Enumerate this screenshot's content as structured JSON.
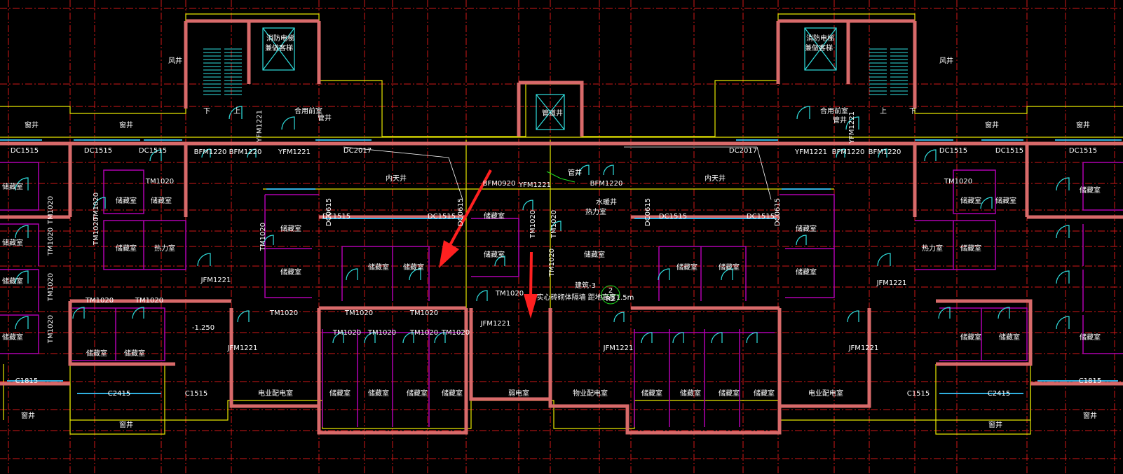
{
  "colors": {
    "background": "#000000",
    "grid": "#d01818",
    "outline": "#e8e800",
    "wall": "#d86a6a",
    "wall_fill": "#e0a080",
    "partition": "#b000b0",
    "door": "#30e0e0",
    "window": "#30b0e0",
    "text": "#ffffff",
    "arrow": "#ff2020",
    "annotation": "#20e020"
  },
  "arrows": [
    {
      "name": "red-arrow-left",
      "note": "pointer"
    },
    {
      "name": "red-arrow-center",
      "note": "pointer"
    }
  ],
  "labels": [
    {
      "t": "消防电梯",
      "id": "l1"
    },
    {
      "t": "兼做客梯",
      "id": "l2"
    },
    {
      "t": "消防电梯",
      "id": "l3"
    },
    {
      "t": "兼做客梯",
      "id": "l4"
    },
    {
      "t": "管道井",
      "id": "l5"
    },
    {
      "t": "风井",
      "id": "l6"
    },
    {
      "t": "风井",
      "id": "l7"
    },
    {
      "t": "窗井",
      "id": "l8"
    },
    {
      "t": "窗井",
      "id": "l9"
    },
    {
      "t": "窗井",
      "id": "l10"
    },
    {
      "t": "窗井",
      "id": "l11"
    },
    {
      "t": "窗井",
      "id": "l12"
    },
    {
      "t": "窗井",
      "id": "l13"
    },
    {
      "t": "窗井",
      "id": "l14"
    },
    {
      "t": "窗井",
      "id": "l15"
    },
    {
      "t": "合用前室",
      "id": "l16"
    },
    {
      "t": "合用前室",
      "id": "l17"
    },
    {
      "t": "下",
      "id": "l18"
    },
    {
      "t": "上",
      "id": "l19"
    },
    {
      "t": "上",
      "id": "l20"
    },
    {
      "t": "下",
      "id": "l21"
    },
    {
      "t": "管井",
      "id": "l22"
    },
    {
      "t": "管井",
      "id": "l23"
    },
    {
      "t": "管井",
      "id": "l24"
    },
    {
      "t": "内天井",
      "id": "l25"
    },
    {
      "t": "内天井",
      "id": "l26"
    },
    {
      "t": "水暖井",
      "id": "l27"
    },
    {
      "t": "热力室",
      "id": "l28"
    },
    {
      "t": "热力室",
      "id": "l29"
    },
    {
      "t": "热力室",
      "id": "l30"
    },
    {
      "t": "储藏室",
      "id": "l31"
    },
    {
      "t": "储藏室",
      "id": "l32"
    },
    {
      "t": "储藏室",
      "id": "l33"
    },
    {
      "t": "储藏室",
      "id": "l34"
    },
    {
      "t": "储藏室",
      "id": "l35"
    },
    {
      "t": "储藏室",
      "id": "l36"
    },
    {
      "t": "储藏室",
      "id": "l37"
    },
    {
      "t": "储藏室",
      "id": "l38"
    },
    {
      "t": "储藏室",
      "id": "l39"
    },
    {
      "t": "储藏室",
      "id": "l40"
    },
    {
      "t": "储藏室",
      "id": "l41"
    },
    {
      "t": "储藏室",
      "id": "l42"
    },
    {
      "t": "储藏室",
      "id": "l43"
    },
    {
      "t": "储藏室",
      "id": "l44"
    },
    {
      "t": "储藏室",
      "id": "l45"
    },
    {
      "t": "储藏室",
      "id": "l46"
    },
    {
      "t": "储藏室",
      "id": "l47"
    },
    {
      "t": "储藏室",
      "id": "l48"
    },
    {
      "t": "储藏室",
      "id": "l49"
    },
    {
      "t": "储藏室",
      "id": "l50"
    },
    {
      "t": "储藏室",
      "id": "l51"
    },
    {
      "t": "储藏室",
      "id": "l52"
    },
    {
      "t": "储藏室",
      "id": "l53"
    },
    {
      "t": "储藏室",
      "id": "l54"
    },
    {
      "t": "储藏室",
      "id": "l55"
    },
    {
      "t": "储藏室",
      "id": "l56"
    },
    {
      "t": "储藏室",
      "id": "l57"
    },
    {
      "t": "储藏室",
      "id": "l58"
    },
    {
      "t": "储藏室",
      "id": "l59"
    },
    {
      "t": "储藏室",
      "id": "l60"
    },
    {
      "t": "储藏室",
      "id": "l61"
    },
    {
      "t": "储藏室",
      "id": "l62"
    },
    {
      "t": "储藏室",
      "id": "l63"
    },
    {
      "t": "储藏室",
      "id": "l64"
    },
    {
      "t": "储藏室",
      "id": "l65"
    },
    {
      "t": "电业配电室",
      "id": "l66"
    },
    {
      "t": "电业配电室",
      "id": "l67"
    },
    {
      "t": "物业配电室",
      "id": "l68"
    },
    {
      "t": "弱电室",
      "id": "l69"
    },
    {
      "t": "BFM1220",
      "id": "l70"
    },
    {
      "t": "BFM1220",
      "id": "l71"
    },
    {
      "t": "BFM1220",
      "id": "l72"
    },
    {
      "t": "BFM1220",
      "id": "l73"
    },
    {
      "t": "BFM1220",
      "id": "l74"
    },
    {
      "t": "BFM0920",
      "id": "l75"
    },
    {
      "t": "YFM1221",
      "id": "l76"
    },
    {
      "t": "YFM1221",
      "id": "l77"
    },
    {
      "t": "YFM1221",
      "id": "l78"
    },
    {
      "t": "YFM1221",
      "id": "l79"
    },
    {
      "t": "YFM1221",
      "id": "l80"
    },
    {
      "t": "JFM1221",
      "id": "l81"
    },
    {
      "t": "JFM1221",
      "id": "l82"
    },
    {
      "t": "JFM1221",
      "id": "l83"
    },
    {
      "t": "JFM1221",
      "id": "l84"
    },
    {
      "t": "JFM1221",
      "id": "l85"
    },
    {
      "t": "JFM1221",
      "id": "l86"
    },
    {
      "t": "DC1515",
      "id": "l87"
    },
    {
      "t": "DC1515",
      "id": "l88"
    },
    {
      "t": "DC1515",
      "id": "l89"
    },
    {
      "t": "DC1515",
      "id": "l90"
    },
    {
      "t": "DC1515",
      "id": "l91"
    },
    {
      "t": "DC1515",
      "id": "l92"
    },
    {
      "t": "DC1515",
      "id": "l93"
    },
    {
      "t": "DC1515",
      "id": "l94"
    },
    {
      "t": "DC1515",
      "id": "l95"
    },
    {
      "t": "DC1515",
      "id": "l96"
    },
    {
      "t": "DC2017",
      "id": "l97"
    },
    {
      "t": "DC2017",
      "id": "l98"
    },
    {
      "t": "C1515",
      "id": "l99"
    },
    {
      "t": "C1515",
      "id": "l100"
    },
    {
      "t": "C2415",
      "id": "l101"
    },
    {
      "t": "C2415",
      "id": "l102"
    },
    {
      "t": "C1815",
      "id": "l103"
    },
    {
      "t": "C1815",
      "id": "l104"
    },
    {
      "t": "TM1020",
      "id": "l105"
    },
    {
      "t": "TM1020",
      "id": "l106"
    },
    {
      "t": "TM1020",
      "id": "l107"
    },
    {
      "t": "TM1020",
      "id": "l108"
    },
    {
      "t": "TM1020",
      "id": "l109"
    },
    {
      "t": "TM1020",
      "id": "l110"
    },
    {
      "t": "TM1020",
      "id": "l111"
    },
    {
      "t": "TM1020",
      "id": "l112"
    },
    {
      "t": "TM1020",
      "id": "l113"
    },
    {
      "t": "TM1020",
      "id": "l114"
    },
    {
      "t": "TM1020",
      "id": "l115"
    },
    {
      "t": "TM1020",
      "id": "l116"
    },
    {
      "t": "TM1020",
      "id": "l117"
    },
    {
      "t": "TM1020",
      "id": "l118"
    },
    {
      "t": "TM1020",
      "id": "l119"
    },
    {
      "t": "TM1020",
      "id": "l120"
    },
    {
      "t": "TM1020",
      "id": "l121"
    },
    {
      "t": "TM1020",
      "id": "l122"
    },
    {
      "t": "TM1020",
      "id": "l123"
    },
    {
      "t": "TM1020",
      "id": "l124"
    },
    {
      "t": "TM1020",
      "id": "l125"
    },
    {
      "t": "TM1020",
      "id": "l126"
    },
    {
      "t": "-1.250",
      "id": "l127"
    },
    {
      "t": "建筑-3",
      "id": "l128"
    },
    {
      "t": "2",
      "id": "l129"
    },
    {
      "t": "R2",
      "id": "l130"
    },
    {
      "t": "实心砖砌体隔墙 距地高度1.5m",
      "id": "l131"
    },
    {
      "t": "DC0615",
      "id": "l132"
    },
    {
      "t": "DC0615",
      "id": "l133"
    },
    {
      "t": "DC0615",
      "id": "l134"
    },
    {
      "t": "DC0615",
      "id": "l135"
    }
  ]
}
